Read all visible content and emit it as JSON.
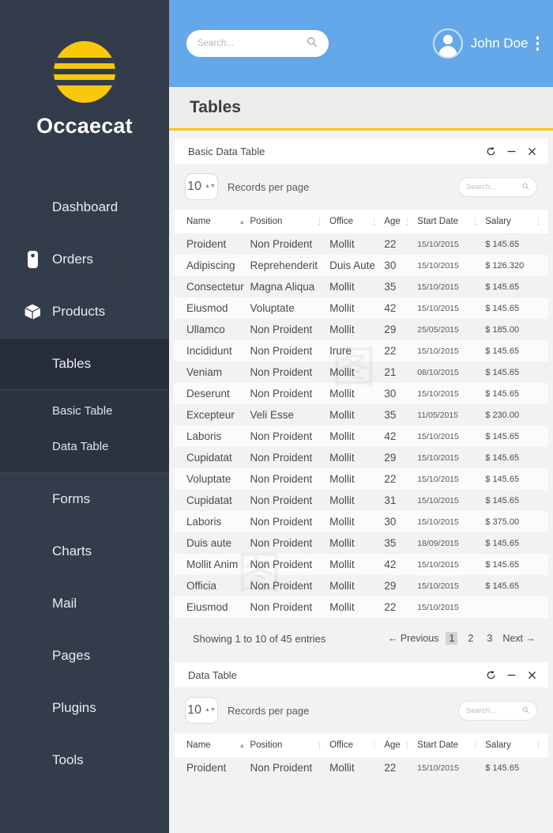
{
  "brand": {
    "name": "Occaecat",
    "logo_icon": "striped-sun-logo",
    "accent_yellow": "#fac80a",
    "sidebar_bg": "#333c4b"
  },
  "sidebar": {
    "items": [
      {
        "label": "Dashboard",
        "icon": null,
        "active": false
      },
      {
        "label": "Orders",
        "icon": "tag-icon",
        "active": false
      },
      {
        "label": "Products",
        "icon": "box-icon",
        "active": false
      },
      {
        "label": "Tables",
        "icon": null,
        "active": true
      },
      {
        "label": "Forms",
        "icon": null,
        "active": false
      },
      {
        "label": "Charts",
        "icon": null,
        "active": false
      },
      {
        "label": "Mail",
        "icon": null,
        "active": false
      },
      {
        "label": "Pages",
        "icon": null,
        "active": false
      },
      {
        "label": "Plugins",
        "icon": null,
        "active": false
      },
      {
        "label": "Tools",
        "icon": null,
        "active": false
      }
    ],
    "subitems": [
      {
        "label": "Basic Table"
      },
      {
        "label": "Data Table"
      }
    ]
  },
  "topbar": {
    "search_placeholder": "Search...",
    "search_value": "",
    "search_icon": "search-icon",
    "user_name": "John Doe",
    "avatar_icon": "user-avatar-icon",
    "menu_icon": "kebab-menu-icon",
    "bg": "#64a8ea"
  },
  "page": {
    "title": "Tables"
  },
  "cards": [
    {
      "title": "Basic Data Table",
      "actions": [
        {
          "name": "refresh-icon",
          "glyph": "⟳"
        },
        {
          "name": "minimize-icon",
          "glyph": "—"
        },
        {
          "name": "close-icon",
          "glyph": "✕"
        }
      ],
      "toolbar": {
        "per_page_value": "10",
        "per_page_label": "Records per page",
        "search_placeholder": "Search...",
        "search_value": ""
      },
      "columns": [
        {
          "label": "Name",
          "sort": "▴"
        },
        {
          "label": "Position",
          "sort": "⋮"
        },
        {
          "label": "Office",
          "sort": "⋮"
        },
        {
          "label": "Age",
          "sort": "⋮"
        },
        {
          "label": "Start Date",
          "sort": "⋮"
        },
        {
          "label": "Salary",
          "sort": "⋮"
        }
      ],
      "rows": [
        [
          "Proident",
          "Non Proident",
          "Mollit",
          "22",
          "15/10/2015",
          "$ 145.65"
        ],
        [
          "Adipiscing",
          "Reprehenderit",
          "Duis Aute",
          "30",
          "15/10/2015",
          "$ 126.320"
        ],
        [
          "Consectetur",
          "Magna Aliqua",
          "Mollit",
          "35",
          "15/10/2015",
          "$ 145.65"
        ],
        [
          "Eiusmod",
          "Voluptate",
          "Mollit",
          "42",
          "15/10/2015",
          "$ 145.65"
        ],
        [
          "Ullamco",
          "Non Proident",
          "Mollit",
          "29",
          "25/05/2015",
          "$ 185.00"
        ],
        [
          "Incididunt",
          "Non Proident",
          "Irure",
          "22",
          "15/10/2015",
          "$ 145.65"
        ],
        [
          "Veniam",
          "Non Proident",
          "Mollit",
          "21",
          "08/10/2015",
          "$ 145.65"
        ],
        [
          "Deserunt",
          "Non Proident",
          "Mollit",
          "30",
          "15/10/2015",
          "$ 145.65"
        ],
        [
          "Excepteur",
          "Veli Esse",
          "Mollit",
          "35",
          "11/05/2015",
          "$ 230.00"
        ],
        [
          "Laboris",
          "Non Proident",
          "Mollit",
          "42",
          "15/10/2015",
          "$ 145.65"
        ],
        [
          "Cupidatat",
          "Non Proident",
          "Mollit",
          "29",
          "15/10/2015",
          "$ 145.65"
        ],
        [
          "Voluptate",
          "Non Proident",
          "Mollit",
          "22",
          "15/10/2015",
          "$ 145.65"
        ],
        [
          "Cupidatat",
          "Non Proident",
          "Mollit",
          "31",
          "15/10/2015",
          "$ 145.65"
        ],
        [
          "Laboris",
          "Non Proident",
          "Mollit",
          "30",
          "15/10/2015",
          "$ 375.00"
        ],
        [
          "Duis aute",
          "Non Proident",
          "Mollit",
          "35",
          "18/09/2015",
          "$ 145.65"
        ],
        [
          "Mollit Anim",
          "Non Proident",
          "Mollit",
          "42",
          "15/10/2015",
          "$ 145.65"
        ],
        [
          "Officia",
          "Non Proident",
          "Mollit",
          "29",
          "15/10/2015",
          "$ 145.65"
        ],
        [
          "Eiusmod",
          "Non Proident",
          "Mollit",
          "22",
          "15/10/2015",
          ""
        ]
      ],
      "footer": {
        "showing": "Showing 1 to 10 of 45 entries",
        "previous": "Previous",
        "next": "Next",
        "pages": [
          "1",
          "2",
          "3"
        ],
        "current_page": "1"
      }
    },
    {
      "title": "Data Table",
      "actions": [
        {
          "name": "refresh-icon",
          "glyph": "⟳"
        },
        {
          "name": "minimize-icon",
          "glyph": "—"
        },
        {
          "name": "close-icon",
          "glyph": "✕"
        }
      ],
      "toolbar": {
        "per_page_value": "10",
        "per_page_label": "Records per page",
        "search_placeholder": "Search...",
        "search_value": ""
      },
      "columns": [
        {
          "label": "Name",
          "sort": "▴"
        },
        {
          "label": "Position",
          "sort": "⋮"
        },
        {
          "label": "Office",
          "sort": "⋮"
        },
        {
          "label": "Age",
          "sort": "⋮"
        },
        {
          "label": "Start Date",
          "sort": "⋮"
        },
        {
          "label": "Salary",
          "sort": "⋮"
        }
      ],
      "rows": [
        [
          "Proident",
          "Non Proident",
          "Mollit",
          "22",
          "15/10/2015",
          "$ 145.65"
        ]
      ]
    }
  ]
}
